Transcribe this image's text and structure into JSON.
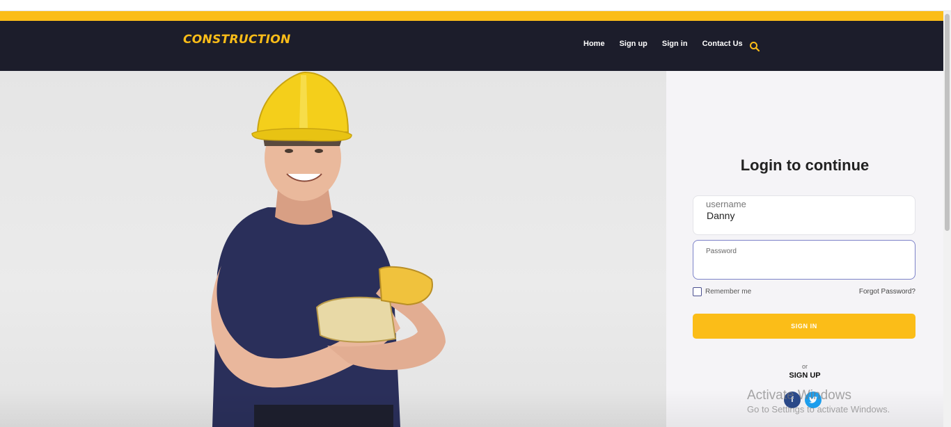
{
  "nav": {
    "brand": "CONSTRUCTION",
    "links": [
      "Home",
      "Sign up",
      "Sign in",
      "Contact Us"
    ],
    "search_icon": "search-icon"
  },
  "colors": {
    "accent": "#fbbd18",
    "navbar": "#1c1d2b",
    "panel": "#f5f4f7",
    "focus_border": "#7c82c8"
  },
  "hero": {
    "image": "construction-worker-photo"
  },
  "login": {
    "title": "Login to continue",
    "username_label": "username",
    "username_value": "Danny",
    "password_label": "Password",
    "remember_label": "Remember me",
    "forgot_label": "Forgot Password?",
    "signin_label": "SIGN IN",
    "or_label": "or",
    "signup_label": "SIGN UP",
    "social_icons": [
      "facebook-icon",
      "twitter-icon"
    ]
  },
  "watermark": {
    "line1": "Activate Windows",
    "line2": "Go to Settings to activate Windows."
  }
}
